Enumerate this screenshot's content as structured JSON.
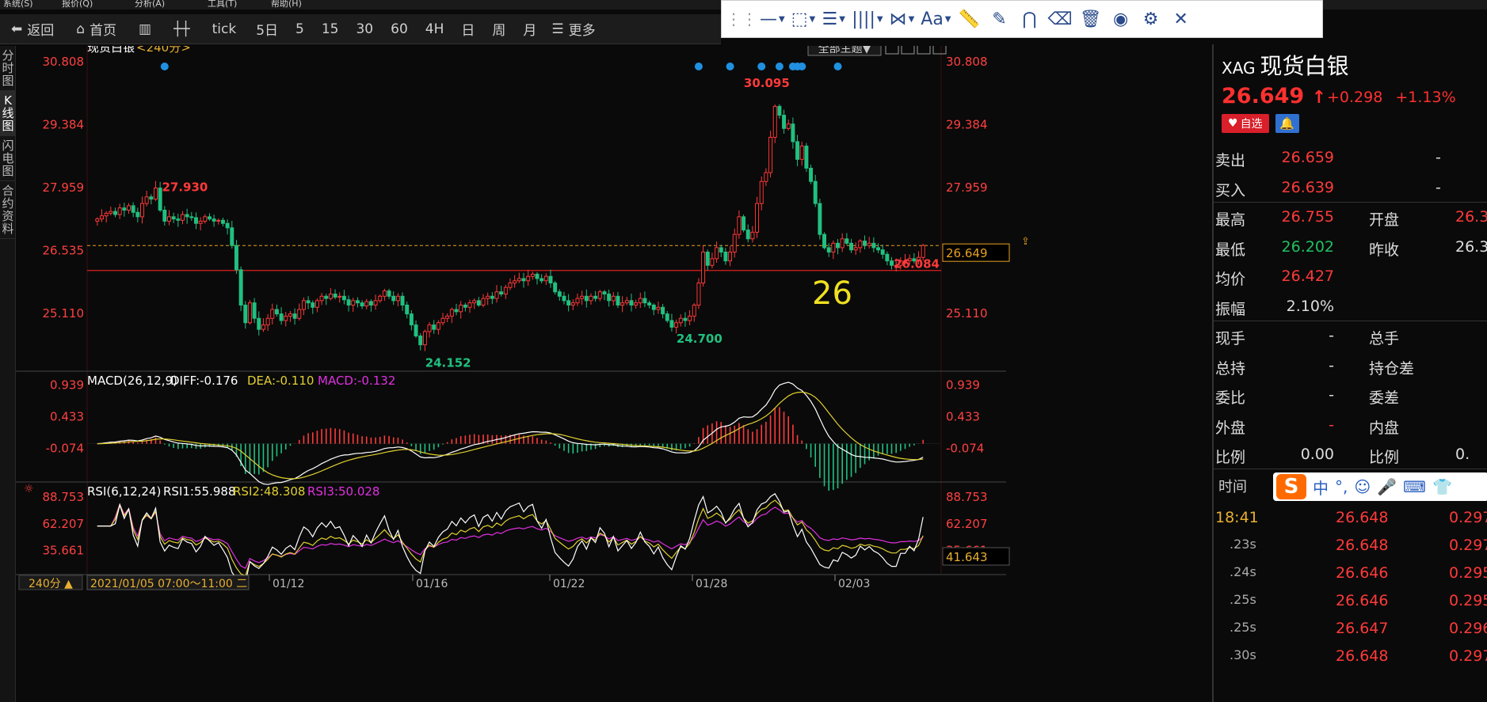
{
  "menu_strip": [
    "系统(S)",
    "报价(Q)",
    "分析(A)",
    "工具(T)",
    "帮助(H)"
  ],
  "toolbar": {
    "back": "返回",
    "home": "首页",
    "tick": "tick",
    "periods": [
      "5日",
      "5",
      "15",
      "30",
      "60",
      "4H",
      "日",
      "周",
      "月"
    ],
    "more": "更多"
  },
  "draw_toolbar": {
    "text_tool": "Aa"
  },
  "left_tabs": [
    "分时图",
    "K线图",
    "闪电图",
    "合约资料"
  ],
  "chart_header": {
    "name": "现货白银",
    "period": "<240分>",
    "theme_button": "全部主题▼"
  },
  "big_label": "26",
  "colors": {
    "up": "#ff3a3a",
    "down": "#20c080",
    "macd_pos": "#ff3a3a",
    "macd_neg": "#20c080",
    "diff": "#ffffff",
    "dea": "#e0d030",
    "macd_label": "#e030e0",
    "rsi1": "#ffffff",
    "rsi2": "#e0d030",
    "rsi3": "#e030e0",
    "axis_text": "#ff4040",
    "price_line": "#e8a020",
    "support_line": "#e02020",
    "dot": "#2090e0"
  },
  "chart_data": [
    {
      "type": "candlestick",
      "title": "现货白银<240分>",
      "yticks": [
        "30.808",
        "29.384",
        "27.959",
        "26.535",
        "25.110"
      ],
      "ylim": [
        24.0,
        30.9
      ],
      "xlabels": [
        "01/12",
        "01/16",
        "01/22",
        "01/28",
        "02/03"
      ],
      "crosshair_date": "2021/01/05 07:00～11:00 二",
      "period_selector": "240分 ▲",
      "annotations": {
        "high_1": "27.930",
        "low_1": "24.152",
        "low_2": "24.700",
        "high_2": "30.095",
        "support": "26.084",
        "last": "26.649"
      },
      "support_value": 26.084,
      "last_value": 26.649,
      "closes": [
        27.25,
        27.32,
        27.38,
        27.42,
        27.35,
        27.5,
        27.45,
        27.55,
        27.4,
        27.3,
        27.6,
        27.75,
        27.7,
        27.95,
        27.45,
        27.2,
        27.3,
        27.25,
        27.22,
        27.35,
        27.3,
        27.28,
        27.15,
        27.2,
        27.3,
        27.25,
        27.2,
        27.22,
        27.15,
        27.05,
        26.65,
        26.1,
        25.3,
        24.9,
        25.35,
        25.0,
        24.75,
        24.85,
        25.0,
        25.2,
        25.1,
        24.95,
        25.05,
        25.1,
        25.0,
        25.2,
        25.4,
        25.35,
        25.25,
        25.4,
        25.5,
        25.45,
        25.55,
        25.48,
        25.5,
        25.42,
        25.3,
        25.4,
        25.35,
        25.28,
        25.38,
        25.3,
        25.4,
        25.5,
        25.62,
        25.5,
        25.4,
        25.5,
        25.3,
        25.1,
        24.85,
        24.6,
        24.4,
        24.7,
        24.85,
        24.75,
        24.9,
        25.0,
        25.05,
        25.2,
        25.15,
        25.3,
        25.25,
        25.35,
        25.4,
        25.3,
        25.45,
        25.5,
        25.45,
        25.6,
        25.55,
        25.7,
        25.8,
        25.85,
        25.9,
        25.85,
        25.95,
        26.0,
        25.9,
        25.85,
        25.95,
        25.8,
        25.6,
        25.5,
        25.4,
        25.3,
        25.35,
        25.45,
        25.5,
        25.4,
        25.5,
        25.45,
        25.6,
        25.55,
        25.4,
        25.5,
        25.3,
        25.35,
        25.4,
        25.3,
        25.35,
        25.45,
        25.35,
        25.3,
        25.2,
        25.25,
        25.1,
        24.95,
        24.8,
        24.9,
        25.0,
        24.95,
        25.05,
        25.3,
        25.8,
        26.5,
        26.2,
        26.35,
        26.6,
        26.5,
        26.3,
        26.5,
        26.9,
        27.3,
        27.0,
        26.8,
        26.95,
        27.6,
        28.1,
        28.3,
        29.1,
        29.8,
        29.6,
        29.3,
        29.4,
        29.0,
        28.6,
        28.9,
        28.4,
        28.1,
        27.6,
        26.9,
        26.6,
        26.5,
        26.7,
        26.6,
        26.8,
        26.7,
        26.55,
        26.6,
        26.75,
        26.65,
        26.7,
        26.6,
        26.55,
        26.45,
        26.3,
        26.2,
        26.2,
        26.3,
        26.3,
        26.35,
        26.3,
        26.38,
        26.649
      ],
      "indicators": [
        {
          "type": "line",
          "name": "MACD(26,12,9)",
          "labels": {
            "diff": "DIFF:-0.176",
            "dea": "DEA:-0.110",
            "macd": "MACD:-0.132"
          },
          "yticks": [
            "0.939",
            "0.433",
            "-0.074"
          ],
          "ylim": [
            -0.5,
            1.05
          ]
        },
        {
          "type": "line",
          "name": "RSI(6,12,24)",
          "labels": {
            "rsi1": "RSI1:55.988",
            "rsi2": "RSI2:48.308",
            "rsi3": "RSI3:50.028"
          },
          "yticks": [
            "88.753",
            "62.207",
            "35.661"
          ],
          "right_tag": "41.643",
          "ylim": [
            15,
            95
          ]
        }
      ]
    }
  ],
  "quote": {
    "symbol": "XAG",
    "name": "现货白银",
    "price": "26.649",
    "arrow": "↑",
    "change": "+0.298",
    "change_pct": "+1.13%",
    "fav_label": "自选",
    "rows": [
      {
        "l1": "卖出",
        "v1": "26.659",
        "l2": "-",
        "v2": "",
        "c1": "red",
        "c2": "white"
      },
      {
        "l1": "买入",
        "v1": "26.639",
        "l2": "-",
        "v2": "",
        "c1": "red",
        "c2": "white"
      },
      {
        "l1": "最高",
        "v1": "26.755",
        "l2": "开盘",
        "v2": "26.3",
        "c1": "red",
        "c2": "red"
      },
      {
        "l1": "最低",
        "v1": "26.202",
        "l2": "昨收",
        "v2": "26.3",
        "c1": "green",
        "c2": "white"
      },
      {
        "l1": "均价",
        "v1": "26.427",
        "l2": "",
        "v2": "",
        "c1": "red",
        "c2": "white"
      },
      {
        "l1": "振幅",
        "v1": "2.10%",
        "l2": "",
        "v2": "",
        "c1": "white",
        "c2": "white"
      },
      {
        "l1": "现手",
        "v1": "-",
        "l2": "总手",
        "v2": "",
        "c1": "white",
        "c2": "white"
      },
      {
        "l1": "总持",
        "v1": "-",
        "l2": "持仓差",
        "v2": "",
        "c1": "white",
        "c2": "white"
      },
      {
        "l1": "委比",
        "v1": "-",
        "l2": "委差",
        "v2": "",
        "c1": "white",
        "c2": "white"
      },
      {
        "l1": "外盘",
        "v1": "-",
        "l2": "内盘",
        "v2": "",
        "c1": "red",
        "c2": "white"
      },
      {
        "l1": "比例",
        "v1": "0.00",
        "l2": "比例",
        "v2": "0.",
        "c1": "white",
        "c2": "white"
      }
    ],
    "tick_header": "时间",
    "ime": [
      "中",
      "°,",
      "☺",
      "🎤",
      "⌨",
      "👕"
    ],
    "ticks": [
      {
        "time": "18:41",
        "price": "26.648",
        "vol": "0.297"
      },
      {
        "time": ".23s",
        "price": "26.648",
        "vol": "0.297"
      },
      {
        "time": ".24s",
        "price": "26.646",
        "vol": "0.295"
      },
      {
        "time": ".25s",
        "price": "26.646",
        "vol": "0.295"
      },
      {
        "time": ".25s",
        "price": "26.647",
        "vol": "0.296"
      },
      {
        "time": ".30s",
        "price": "26.648",
        "vol": "0.297"
      }
    ]
  }
}
